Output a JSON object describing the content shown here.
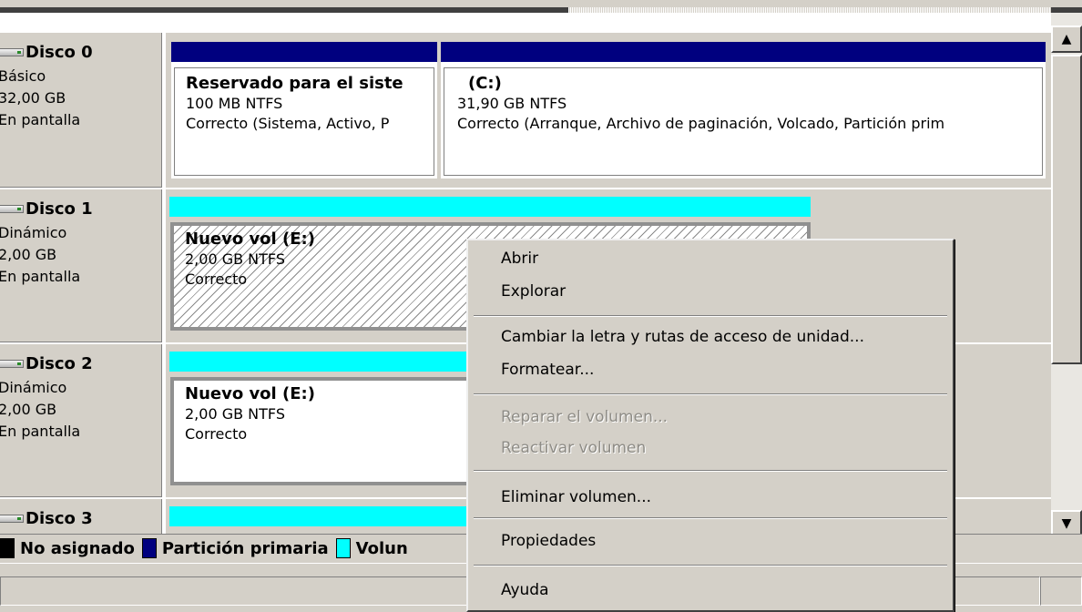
{
  "disks": [
    {
      "name": "Disco 0",
      "type": "Básico",
      "size": "32,00 GB",
      "status": "En pantalla",
      "partitions": [
        {
          "title": "Reservado para el siste",
          "fs": "100 MB NTFS",
          "health": "Correcto (Sistema, Activo, P",
          "bar_color": "#00007f"
        },
        {
          "title": "(C:)",
          "fs": "31,90 GB NTFS",
          "health": "Correcto (Arranque, Archivo de paginación, Volcado, Partición prim",
          "bar_color": "#00007f"
        }
      ]
    },
    {
      "name": "Disco 1",
      "type": "Dinámico",
      "size": "2,00 GB",
      "status": "En pantalla",
      "partitions": [
        {
          "title": "Nuevo vol  (E:)",
          "fs": "2,00 GB NTFS",
          "health": "Correcto",
          "bar_color": "#00ffff",
          "selected": true
        }
      ]
    },
    {
      "name": "Disco 2",
      "type": "Dinámico",
      "size": "2,00 GB",
      "status": "En pantalla",
      "partitions": [
        {
          "title": "Nuevo vol  (E:)",
          "fs": "2,00 GB NTFS",
          "health": "Correcto",
          "bar_color": "#00ffff"
        }
      ]
    },
    {
      "name": "Disco 3",
      "bar_color": "#00ffff"
    }
  ],
  "legend": [
    {
      "label": "No asignado",
      "color": "#000000"
    },
    {
      "label": "Partición primaria",
      "color": "#00007f"
    },
    {
      "label": "Volun",
      "color": "#00ffff"
    }
  ],
  "context_menu": {
    "items": [
      {
        "label": "Abrir",
        "enabled": true
      },
      {
        "label": "Explorar",
        "enabled": true
      },
      {
        "label": "Cambiar la letra y rutas de acceso de unidad...",
        "enabled": true
      },
      {
        "label": "Formatear...",
        "enabled": true
      },
      {
        "label": "Reparar el volumen...",
        "enabled": false
      },
      {
        "label": "Reactivar volumen",
        "enabled": false
      },
      {
        "label": "Eliminar volumen...",
        "enabled": true
      },
      {
        "label": "Propiedades",
        "enabled": true
      },
      {
        "label": "Ayuda",
        "enabled": true
      }
    ]
  },
  "scrollbar": {
    "up_icon": "arrow-up-icon",
    "down_icon": "arrow-down-icon"
  }
}
